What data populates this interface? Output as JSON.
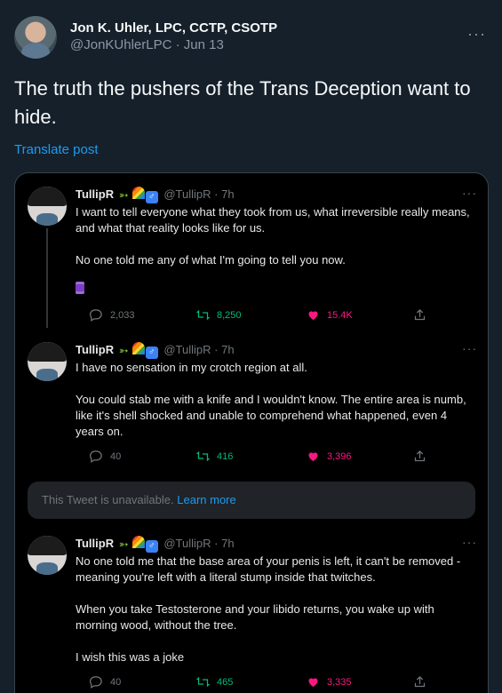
{
  "outer": {
    "author_name": "Jon K. Uhler, LPC, CCTP, CSOTP",
    "handle": "@JonKUhlerLPC",
    "date": "Jun 13",
    "meta_separator": "·",
    "more": "···",
    "text": "The truth the pushers of the Trans Deception want to hide.",
    "translate": "Translate post"
  },
  "thread_author": {
    "name": "TullipR",
    "handle": "@TullipR",
    "time": "7h",
    "separator": "·",
    "emojis": [
      "snake-emoji",
      "rainbow-emoji",
      "male-sign-emoji"
    ],
    "more": "···"
  },
  "tweets": [
    {
      "paragraphs": [
        "I want to tell everyone what they took from us, what irreversible really means, and what that reality looks like for us.",
        "No one told me any of what I'm going to tell you now."
      ],
      "emoji": "spool-of-thread-emoji",
      "replies": "2,033",
      "retweets": "8,250",
      "likes": "15.4K"
    },
    {
      "paragraphs": [
        "I have no sensation in my crotch region at all.",
        "You could stab me with a knife and I wouldn't know. The entire area is numb, like it's shell shocked and unable to comprehend what happened, even 4 years on."
      ],
      "replies": "40",
      "retweets": "416",
      "likes": "3,396"
    },
    {
      "paragraphs": [
        "No one told me that the base area of your penis is left, it can't be removed - meaning you're left with a literal stump inside that twitches.",
        "When you take Testosterone and your libido returns, you wake up with morning wood, without the tree.",
        "I wish this was a joke"
      ],
      "replies": "40",
      "retweets": "465",
      "likes": "3,335"
    }
  ],
  "unavailable": {
    "text": "This Tweet is unavailable.",
    "link": "Learn more"
  },
  "colors": {
    "background": "#15202b",
    "embed_background": "#000000",
    "link_blue": "#1d9bf0",
    "retweet_green": "#00ba7c",
    "like_pink": "#f91880",
    "muted": "#71767b"
  }
}
